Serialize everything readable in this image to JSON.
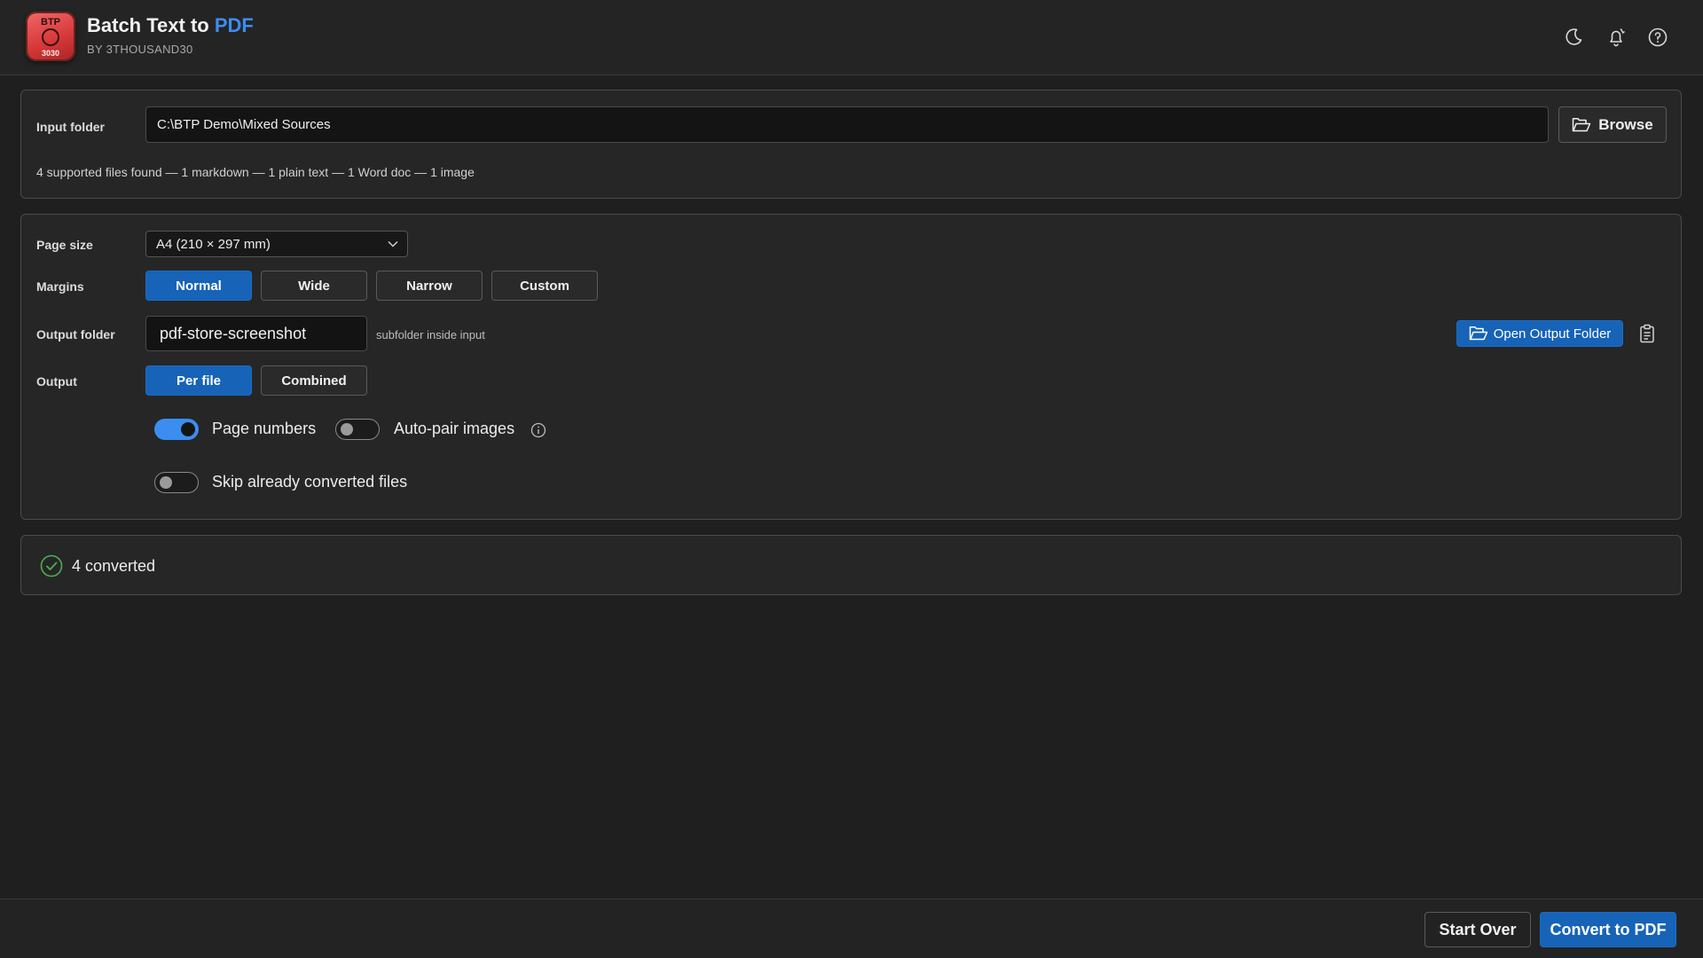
{
  "app": {
    "title_main": "Batch Text to ",
    "title_accent": "PDF",
    "subtitle": "BY 3THOUSAND30",
    "logo_top": "BTP",
    "logo_bottom": "3030"
  },
  "header_icons": [
    "moon-icon",
    "bell-icon",
    "help-icon"
  ],
  "input": {
    "label": "Input folder",
    "path": "C:\\BTP Demo\\Mixed Sources",
    "browse_label": "Browse",
    "summary": "4 supported files found — 1 markdown — 1 plain text — 1 Word doc — 1 image"
  },
  "settings": {
    "page_size_label": "Page size",
    "page_size_value": "A4 (210 × 297 mm)",
    "margins_label": "Margins",
    "margins": [
      "Normal",
      "Wide",
      "Narrow",
      "Custom"
    ],
    "margins_selected": "Normal",
    "output_folder_label": "Output folder",
    "output_folder_value": "pdf-store-screenshot",
    "output_folder_hint": "subfolder inside input",
    "open_output_label": "Open Output Folder",
    "output_label": "Output",
    "output_modes": [
      "Per file",
      "Combined"
    ],
    "output_selected": "Per file",
    "toggles": {
      "page_numbers": {
        "label": "Page numbers",
        "on": true
      },
      "auto_pair": {
        "label": "Auto-pair images",
        "on": false
      },
      "skip_converted": {
        "label": "Skip already converted files",
        "on": false
      }
    }
  },
  "status": {
    "text": "4 converted"
  },
  "footer": {
    "start_over": "Start Over",
    "convert": "Convert to PDF"
  },
  "colors": {
    "accent": "#1663b8",
    "accent_light": "#3b8ef0",
    "success": "#4caf50",
    "background": "#1f1f1f"
  }
}
